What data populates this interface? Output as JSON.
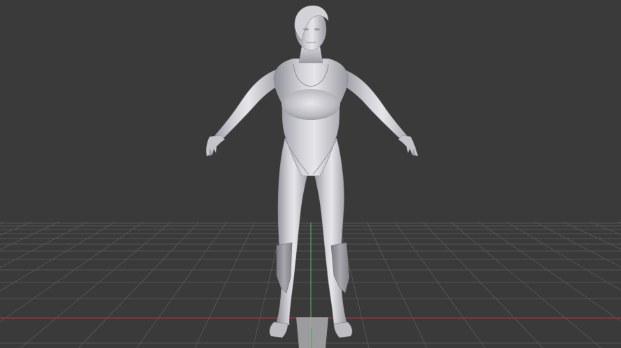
{
  "viewport": {
    "background": "#3a3a3a",
    "grid_color": "#545454",
    "axis_x_color": "#8a3b3b",
    "axis_y_color": "#5aa05a",
    "model_color": "#c9c9cf",
    "model_shadow": "#8e8e96",
    "model_highlight": "#e6e6ea",
    "gizmo_color": "#a7a7aa"
  }
}
